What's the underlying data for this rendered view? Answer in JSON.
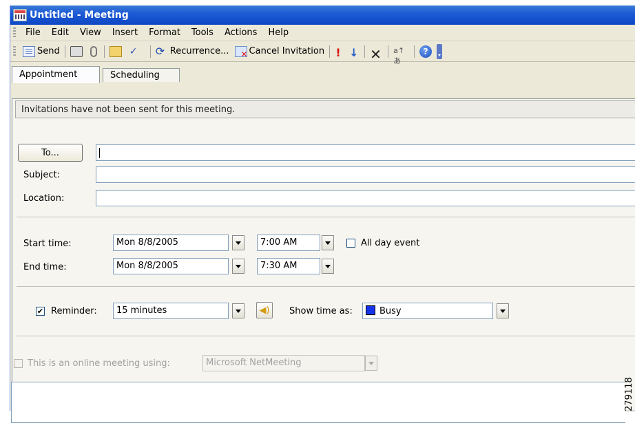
{
  "window": {
    "title": "Untitled - Meeting"
  },
  "menu": [
    "File",
    "Edit",
    "View",
    "Insert",
    "Format",
    "Tools",
    "Actions",
    "Help"
  ],
  "toolbar": {
    "send": "Send",
    "recurrence": "Recurrence...",
    "cancel_invitation": "Cancel Invitation",
    "translate_glyph": "a↑あ"
  },
  "tabs": [
    "Appointment",
    "Scheduling"
  ],
  "info_message": "Invitations have not been sent for this meeting.",
  "form": {
    "to_label": "To...",
    "to_value": "",
    "subject_label": "Subject:",
    "subject_value": "",
    "location_label": "Location:",
    "location_value": "",
    "start_label": "Start time:",
    "start_date": "Mon 8/8/2005",
    "start_time": "7:00 AM",
    "all_day_label": "All day event",
    "all_day_checked": false,
    "end_label": "End time:",
    "end_date": "Mon 8/8/2005",
    "end_time": "7:30 AM",
    "reminder_label": "Reminder:",
    "reminder_checked": true,
    "reminder_value": "15 minutes",
    "show_time_label": "Show time as:",
    "show_time_value": "Busy",
    "busy_color": "#1433ea",
    "online_label": "This is an online meeting using:",
    "online_checked": false,
    "online_value": "Microsoft NetMeeting"
  },
  "watermark": "279118",
  "colors": {
    "titlebar": "#0f47c4",
    "window_bg": "#ece9d8"
  }
}
